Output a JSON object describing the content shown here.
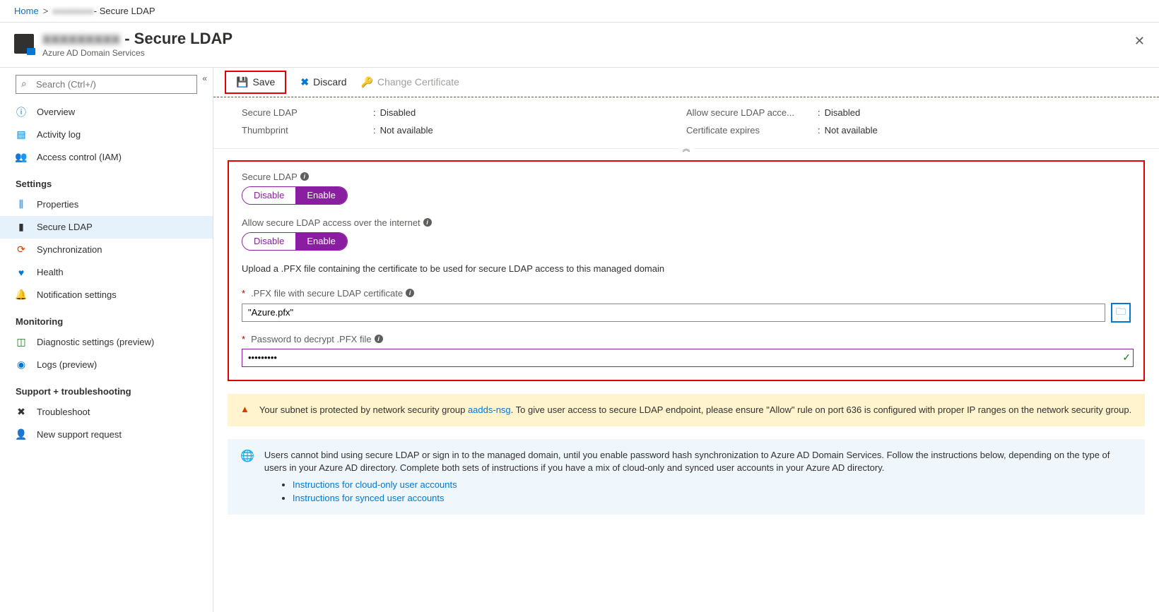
{
  "breadcrumb": {
    "home": "Home",
    "domain_blur": "xxxxxxxxx",
    "suffix": " - Secure LDAP"
  },
  "header": {
    "title_blur": "xxxxxxxxx",
    "title_suffix": " - Secure LDAP",
    "subtitle": "Azure AD Domain Services"
  },
  "search": {
    "placeholder": "Search (Ctrl+/)"
  },
  "nav": {
    "overview": "Overview",
    "activity": "Activity log",
    "iam": "Access control (IAM)",
    "settings_head": "Settings",
    "properties": "Properties",
    "secure_ldap": "Secure LDAP",
    "sync": "Synchronization",
    "health": "Health",
    "notif": "Notification settings",
    "monitoring_head": "Monitoring",
    "diag": "Diagnostic settings (preview)",
    "logs": "Logs (preview)",
    "support_head": "Support + troubleshooting",
    "troubleshoot": "Troubleshoot",
    "new_request": "New support request"
  },
  "toolbar": {
    "save": "Save",
    "discard": "Discard",
    "change_cert": "Change Certificate"
  },
  "info": {
    "secure_ldap_label": "Secure LDAP",
    "secure_ldap_value": "Disabled",
    "thumbprint_label": "Thumbprint",
    "thumbprint_value": "Not available",
    "allow_label": "Allow secure LDAP acce...",
    "allow_value": "Disabled",
    "cert_exp_label": "Certificate expires",
    "cert_exp_value": "Not available"
  },
  "form": {
    "secure_ldap_label": "Secure LDAP",
    "allow_internet_label": "Allow secure LDAP access over the internet",
    "disable": "Disable",
    "enable": "Enable",
    "upload_desc": "Upload a .PFX file containing the certificate to be used for secure LDAP access to this managed domain",
    "pfx_label": ".PFX file with secure LDAP certificate",
    "pfx_value": "\"Azure.pfx\"",
    "pwd_label": "Password to decrypt .PFX file",
    "pwd_value": "•••••••••"
  },
  "callouts": {
    "warn_prefix": "Your subnet is protected by network security group ",
    "warn_link": "aadds-nsg",
    "warn_suffix": ". To give user access to secure LDAP endpoint, please ensure \"Allow\" rule on port 636 is configured with proper IP ranges on the network security group.",
    "info_text": "Users cannot bind using secure LDAP or sign in to the managed domain, until you enable password hash synchronization to Azure AD Domain Services. Follow the instructions below, depending on the type of users in your Azure AD directory. Complete both sets of instructions if you have a mix of cloud-only and synced user accounts in your Azure AD directory.",
    "info_link1": "Instructions for cloud-only user accounts",
    "info_link2": "Instructions for synced user accounts"
  }
}
